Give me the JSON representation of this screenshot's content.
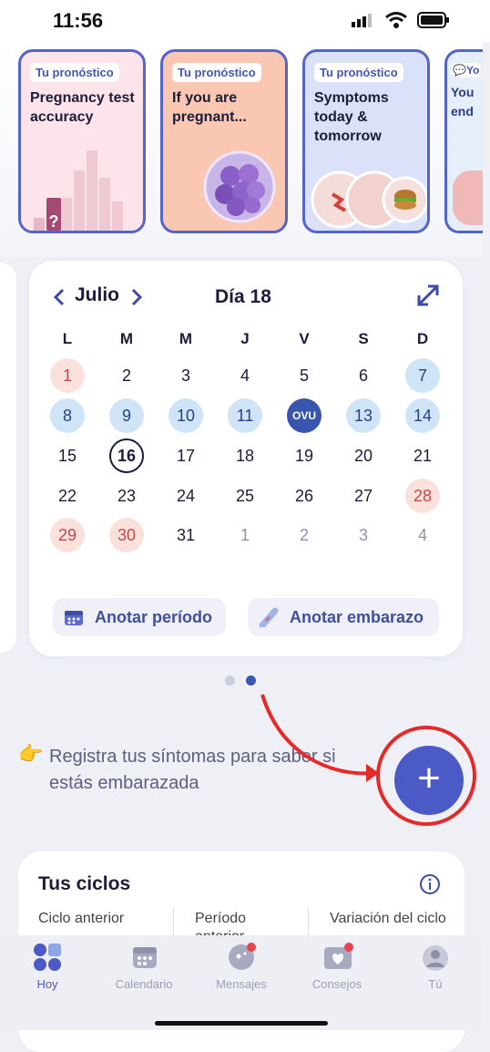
{
  "status": {
    "time": "11:56"
  },
  "cards": [
    {
      "tag": "Tu pronóstico",
      "title": "Pregnancy test accuracy",
      "bg": "#fce4ea"
    },
    {
      "tag": "Tu pronóstico",
      "title": "If you are pregnant...",
      "bg": "#f9c7b2"
    },
    {
      "tag": "Tu pronóstico",
      "title": "Symptoms today & tomorrow",
      "bg": "#dbe1f8"
    },
    {
      "tag": "💬Yo",
      "title": "You end",
      "bg": "#e6eef9"
    }
  ],
  "calendar": {
    "month": "Julio",
    "day_label": "Día 18",
    "weekdays": [
      "L",
      "M",
      "M",
      "J",
      "V",
      "S",
      "D"
    ],
    "weeks": [
      [
        {
          "d": "1",
          "s": "red"
        },
        {
          "d": "2"
        },
        {
          "d": "3"
        },
        {
          "d": "4"
        },
        {
          "d": "5"
        },
        {
          "d": "6"
        },
        {
          "d": "7",
          "s": "blue"
        }
      ],
      [
        {
          "d": "8",
          "s": "blue"
        },
        {
          "d": "9",
          "s": "blue"
        },
        {
          "d": "10",
          "s": "blue"
        },
        {
          "d": "11",
          "s": "blue"
        },
        {
          "d": "OVU",
          "s": "ovu"
        },
        {
          "d": "13",
          "s": "blue"
        },
        {
          "d": "14",
          "s": "blue"
        }
      ],
      [
        {
          "d": "15"
        },
        {
          "d": "16",
          "s": "today"
        },
        {
          "d": "17"
        },
        {
          "d": "18"
        },
        {
          "d": "19"
        },
        {
          "d": "20"
        },
        {
          "d": "21"
        }
      ],
      [
        {
          "d": "22"
        },
        {
          "d": "23"
        },
        {
          "d": "24"
        },
        {
          "d": "25"
        },
        {
          "d": "26"
        },
        {
          "d": "27"
        },
        {
          "d": "28",
          "s": "red"
        }
      ],
      [
        {
          "d": "29",
          "s": "red"
        },
        {
          "d": "30",
          "s": "red"
        },
        {
          "d": "31"
        },
        {
          "d": "1",
          "s": "grey"
        },
        {
          "d": "2",
          "s": "grey"
        },
        {
          "d": "3",
          "s": "grey"
        },
        {
          "d": "4",
          "s": "grey"
        }
      ]
    ],
    "log_period": "Anotar período",
    "log_pregnancy": "Anotar embarazo"
  },
  "prompt": {
    "emoji": "👉",
    "text": "Registra tus síntomas para saber si estás embarazada"
  },
  "ciclos": {
    "title": "Tus ciclos",
    "cols": [
      "Ciclo anterior",
      "Período anterior",
      "Variación del ciclo"
    ]
  },
  "tabs": [
    {
      "label": "Hoy",
      "active": true
    },
    {
      "label": "Calendario"
    },
    {
      "label": "Mensajes",
      "badge": true
    },
    {
      "label": "Consejos",
      "badge": true
    },
    {
      "label": "Tú"
    }
  ],
  "colors": {
    "accent": "#4b5ac6",
    "ring": "#e52a2a"
  }
}
